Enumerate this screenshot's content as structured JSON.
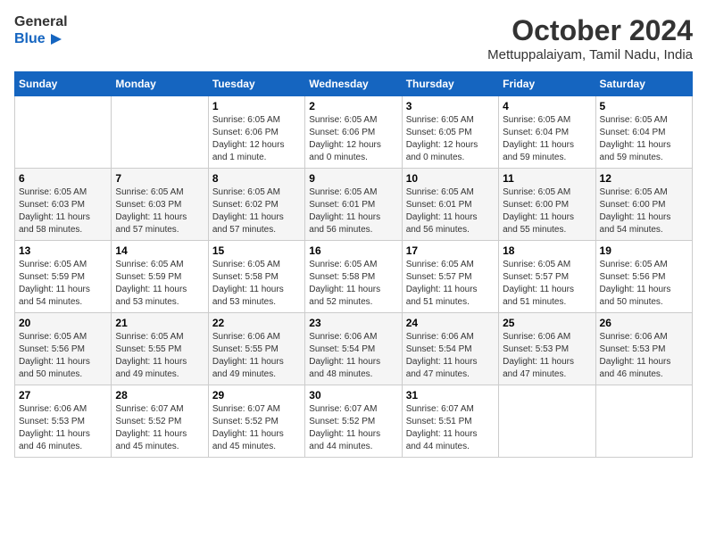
{
  "logo": {
    "general": "General",
    "blue": "Blue"
  },
  "title": "October 2024",
  "location": "Mettuppalaiyam, Tamil Nadu, India",
  "weekdays": [
    "Sunday",
    "Monday",
    "Tuesday",
    "Wednesday",
    "Thursday",
    "Friday",
    "Saturday"
  ],
  "weeks": [
    [
      {
        "day": "",
        "info": ""
      },
      {
        "day": "",
        "info": ""
      },
      {
        "day": "1",
        "info": "Sunrise: 6:05 AM\nSunset: 6:06 PM\nDaylight: 12 hours\nand 1 minute."
      },
      {
        "day": "2",
        "info": "Sunrise: 6:05 AM\nSunset: 6:06 PM\nDaylight: 12 hours\nand 0 minutes."
      },
      {
        "day": "3",
        "info": "Sunrise: 6:05 AM\nSunset: 6:05 PM\nDaylight: 12 hours\nand 0 minutes."
      },
      {
        "day": "4",
        "info": "Sunrise: 6:05 AM\nSunset: 6:04 PM\nDaylight: 11 hours\nand 59 minutes."
      },
      {
        "day": "5",
        "info": "Sunrise: 6:05 AM\nSunset: 6:04 PM\nDaylight: 11 hours\nand 59 minutes."
      }
    ],
    [
      {
        "day": "6",
        "info": "Sunrise: 6:05 AM\nSunset: 6:03 PM\nDaylight: 11 hours\nand 58 minutes."
      },
      {
        "day": "7",
        "info": "Sunrise: 6:05 AM\nSunset: 6:03 PM\nDaylight: 11 hours\nand 57 minutes."
      },
      {
        "day": "8",
        "info": "Sunrise: 6:05 AM\nSunset: 6:02 PM\nDaylight: 11 hours\nand 57 minutes."
      },
      {
        "day": "9",
        "info": "Sunrise: 6:05 AM\nSunset: 6:01 PM\nDaylight: 11 hours\nand 56 minutes."
      },
      {
        "day": "10",
        "info": "Sunrise: 6:05 AM\nSunset: 6:01 PM\nDaylight: 11 hours\nand 56 minutes."
      },
      {
        "day": "11",
        "info": "Sunrise: 6:05 AM\nSunset: 6:00 PM\nDaylight: 11 hours\nand 55 minutes."
      },
      {
        "day": "12",
        "info": "Sunrise: 6:05 AM\nSunset: 6:00 PM\nDaylight: 11 hours\nand 54 minutes."
      }
    ],
    [
      {
        "day": "13",
        "info": "Sunrise: 6:05 AM\nSunset: 5:59 PM\nDaylight: 11 hours\nand 54 minutes."
      },
      {
        "day": "14",
        "info": "Sunrise: 6:05 AM\nSunset: 5:59 PM\nDaylight: 11 hours\nand 53 minutes."
      },
      {
        "day": "15",
        "info": "Sunrise: 6:05 AM\nSunset: 5:58 PM\nDaylight: 11 hours\nand 53 minutes."
      },
      {
        "day": "16",
        "info": "Sunrise: 6:05 AM\nSunset: 5:58 PM\nDaylight: 11 hours\nand 52 minutes."
      },
      {
        "day": "17",
        "info": "Sunrise: 6:05 AM\nSunset: 5:57 PM\nDaylight: 11 hours\nand 51 minutes."
      },
      {
        "day": "18",
        "info": "Sunrise: 6:05 AM\nSunset: 5:57 PM\nDaylight: 11 hours\nand 51 minutes."
      },
      {
        "day": "19",
        "info": "Sunrise: 6:05 AM\nSunset: 5:56 PM\nDaylight: 11 hours\nand 50 minutes."
      }
    ],
    [
      {
        "day": "20",
        "info": "Sunrise: 6:05 AM\nSunset: 5:56 PM\nDaylight: 11 hours\nand 50 minutes."
      },
      {
        "day": "21",
        "info": "Sunrise: 6:05 AM\nSunset: 5:55 PM\nDaylight: 11 hours\nand 49 minutes."
      },
      {
        "day": "22",
        "info": "Sunrise: 6:06 AM\nSunset: 5:55 PM\nDaylight: 11 hours\nand 49 minutes."
      },
      {
        "day": "23",
        "info": "Sunrise: 6:06 AM\nSunset: 5:54 PM\nDaylight: 11 hours\nand 48 minutes."
      },
      {
        "day": "24",
        "info": "Sunrise: 6:06 AM\nSunset: 5:54 PM\nDaylight: 11 hours\nand 47 minutes."
      },
      {
        "day": "25",
        "info": "Sunrise: 6:06 AM\nSunset: 5:53 PM\nDaylight: 11 hours\nand 47 minutes."
      },
      {
        "day": "26",
        "info": "Sunrise: 6:06 AM\nSunset: 5:53 PM\nDaylight: 11 hours\nand 46 minutes."
      }
    ],
    [
      {
        "day": "27",
        "info": "Sunrise: 6:06 AM\nSunset: 5:53 PM\nDaylight: 11 hours\nand 46 minutes."
      },
      {
        "day": "28",
        "info": "Sunrise: 6:07 AM\nSunset: 5:52 PM\nDaylight: 11 hours\nand 45 minutes."
      },
      {
        "day": "29",
        "info": "Sunrise: 6:07 AM\nSunset: 5:52 PM\nDaylight: 11 hours\nand 45 minutes."
      },
      {
        "day": "30",
        "info": "Sunrise: 6:07 AM\nSunset: 5:52 PM\nDaylight: 11 hours\nand 44 minutes."
      },
      {
        "day": "31",
        "info": "Sunrise: 6:07 AM\nSunset: 5:51 PM\nDaylight: 11 hours\nand 44 minutes."
      },
      {
        "day": "",
        "info": ""
      },
      {
        "day": "",
        "info": ""
      }
    ]
  ]
}
